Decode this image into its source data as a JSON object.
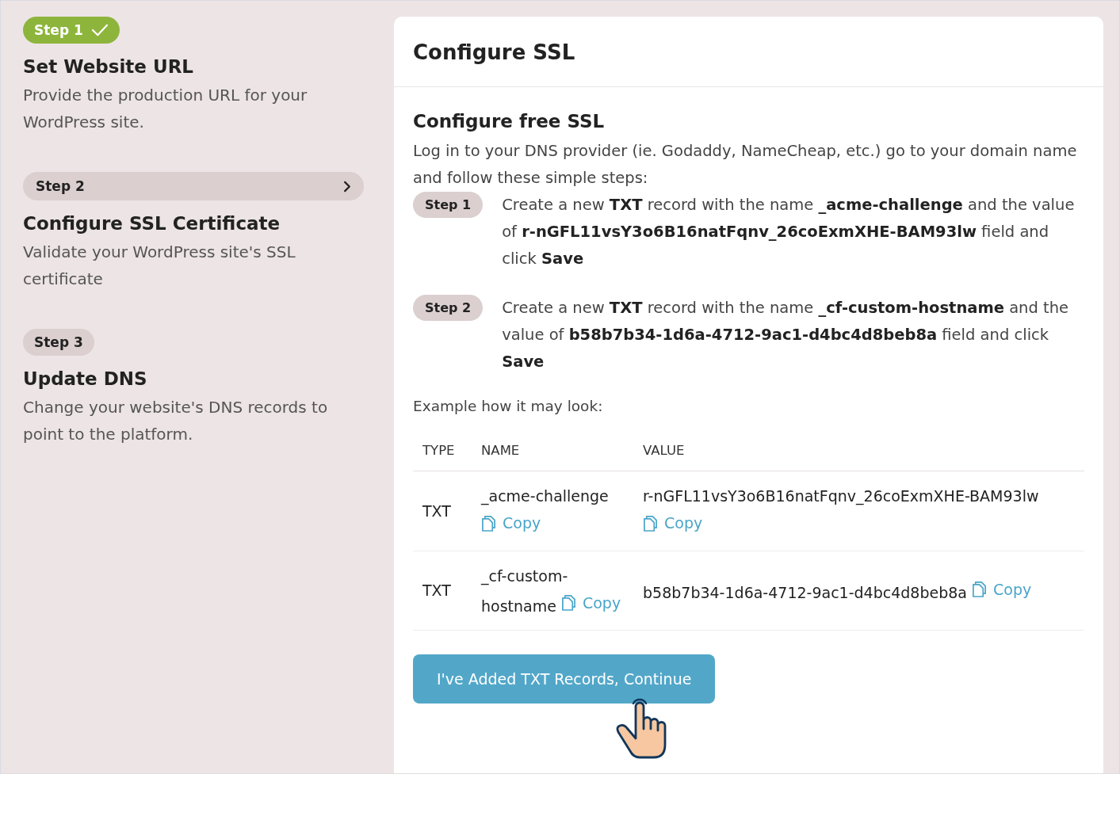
{
  "sidebar": {
    "steps": [
      {
        "badge": "Step 1",
        "kind": "done",
        "title": "Set Website URL",
        "description": "Provide the production URL for your WordPress site."
      },
      {
        "badge": "Step 2",
        "kind": "current",
        "title": "Configure SSL Certificate",
        "description": "Validate your WordPress site's SSL certificate"
      },
      {
        "badge": "Step 3",
        "kind": "pending",
        "title": "Update DNS",
        "description": "Change your website's DNS records to point to the platform."
      }
    ]
  },
  "panel": {
    "title": "Configure SSL",
    "section_title": "Configure free SSL",
    "intro": "Log in to your DNS provider (ie. Godaddy, NameCheap, etc.) go to your domain name and follow these simple steps:",
    "instructions": [
      {
        "badge": "Step 1",
        "text": "Create a new **TXT** record with the name **_acme-challenge** and the value of **r-nGFL11vsY3o6B16natFqnv_26coExmXHE-BAM93lw** field and click **Save**"
      },
      {
        "badge": "Step 2",
        "text": "Create a new **TXT** record with the name **_cf-custom-hostname** and the value of **b58b7b34-1d6a-4712-9ac1-d4bc4d8beb8a** field and click **Save**"
      }
    ],
    "example_label": "Example how it may look:",
    "table": {
      "columns": [
        "TYPE",
        "NAME",
        "VALUE"
      ],
      "rows": [
        {
          "type": "TXT",
          "name": "_acme-challenge",
          "name_copy": "Copy",
          "value": "r-nGFL11vsY3o6B16natFqnv_26coExmXHE-BAM93lw",
          "value_copy": "Copy"
        },
        {
          "type": "TXT",
          "name": "_cf-custom-hostname",
          "name_copy": "Copy",
          "value": "b58b7b34-1d6a-4712-9ac1-d4bc4d8beb8a",
          "value_copy": "Copy"
        }
      ]
    },
    "button": "I've Added TXT Records, Continue"
  }
}
